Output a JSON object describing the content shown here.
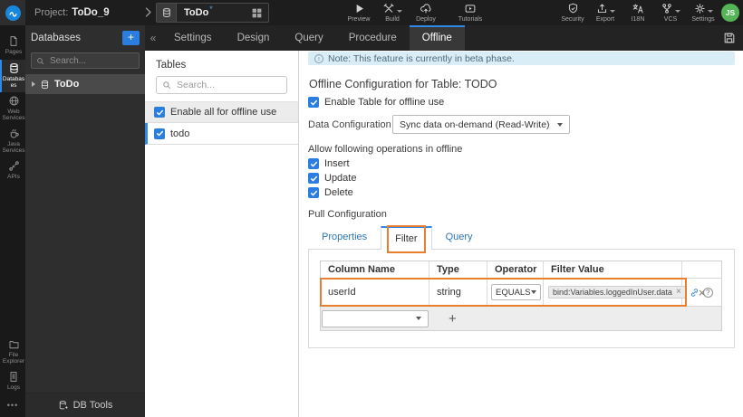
{
  "colors": {
    "accent_blue": "#2e8ae6",
    "checkbox_blue": "#2b7de0",
    "annotation_orange": "#e87e2e",
    "note_bg": "#d9edf7",
    "avatar_green": "#53b556"
  },
  "topbar": {
    "project_prefix": "Project:",
    "project_name": "ToDo_9",
    "asset_tab": {
      "label": "ToDo",
      "modified_mark": "*"
    },
    "actions_left": [
      {
        "label": "Preview",
        "icon": "play-icon"
      },
      {
        "label": "Build",
        "icon": "build-icon"
      },
      {
        "label": "Deploy",
        "icon": "deploy-icon"
      }
    ],
    "tutorials": {
      "label": "Tutorials",
      "icon": "video-icon"
    },
    "actions_right": [
      {
        "label": "Security",
        "icon": "shield-icon"
      },
      {
        "label": "Export",
        "icon": "export-icon"
      },
      {
        "label": "I18N",
        "icon": "i18n-icon"
      },
      {
        "label": "VCS",
        "icon": "vcs-icon"
      },
      {
        "label": "Settings",
        "icon": "gear-icon"
      }
    ],
    "avatar_initials": "JS"
  },
  "sidebar": {
    "items": [
      {
        "label": "Pages",
        "icon": "page-icon"
      },
      {
        "label": "Databases",
        "icon": "database-icon",
        "active": true
      },
      {
        "label": "Web Services",
        "icon": "globe-icon"
      },
      {
        "label": "Java Services",
        "icon": "coffee-icon"
      },
      {
        "label": "APIs",
        "icon": "api-icon"
      }
    ],
    "bottom_items": [
      {
        "label": "File Explorer",
        "icon": "folder-icon"
      },
      {
        "label": "Logs",
        "icon": "logs-icon"
      }
    ],
    "more_glyph": "•••"
  },
  "db_panel": {
    "title": "Databases",
    "add_glyph": "+",
    "collapse_glyph": "«",
    "search_placeholder": "Search...",
    "items": [
      {
        "label": "ToDo"
      }
    ],
    "footer_label": "DB Tools"
  },
  "tabbar": {
    "tabs": [
      {
        "label": "Settings"
      },
      {
        "label": "Design"
      },
      {
        "label": "Query"
      },
      {
        "label": "Procedure"
      },
      {
        "label": "Offline",
        "active": true
      }
    ]
  },
  "tables_panel": {
    "title": "Tables",
    "search_placeholder": "Search...",
    "rows": [
      {
        "label": "Enable all for offline use",
        "checked": true
      },
      {
        "label": "todo",
        "checked": true,
        "selected": true
      }
    ]
  },
  "main": {
    "note_icon_glyph": "i",
    "note_text": "Note: This feature is currently in beta phase.",
    "heading": "Offline Configuration for Table: TODO",
    "enable_table_label": "Enable Table for offline use",
    "data_configuration": {
      "label": "Data Configuration",
      "value": "Sync data on-demand (Read-Write)"
    },
    "operations_heading": "Allow following operations in offline",
    "operations": [
      {
        "label": "Insert",
        "checked": true
      },
      {
        "label": "Update",
        "checked": true
      },
      {
        "label": "Delete",
        "checked": true
      }
    ],
    "pull_configuration_heading": "Pull Configuration",
    "pull_tabs": [
      {
        "label": "Properties"
      },
      {
        "label": "Filter",
        "active": true,
        "highlighted": true
      },
      {
        "label": "Query"
      }
    ],
    "filter_table": {
      "headers": [
        "Column Name",
        "Type",
        "Operator",
        "Filter Value"
      ],
      "rows": [
        {
          "column_name": "userId",
          "type": "string",
          "operator": "EQUALS",
          "filter_value": "bind:Variables.loggedInUser.data",
          "chip_remove_glyph": "×",
          "row_delete_glyph": "×",
          "help_glyph": "?"
        }
      ],
      "add_row_glyph": "+"
    }
  }
}
